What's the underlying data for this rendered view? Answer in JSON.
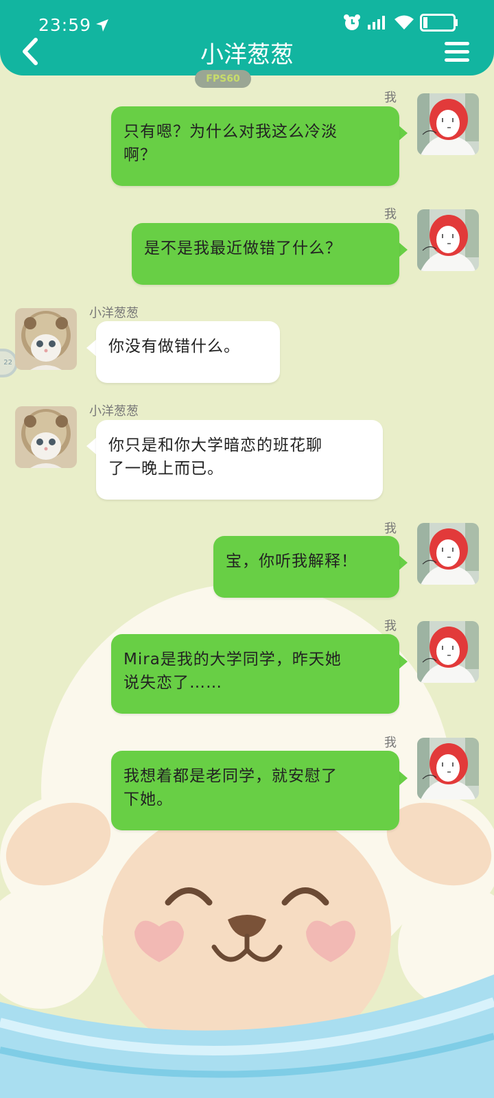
{
  "status_bar": {
    "time": "23:59",
    "location_icon": "navigation-arrow-icon",
    "alarm_icon": "alarm-clock-icon",
    "signal_icon": "signal-bars-icon",
    "wifi_icon": "wifi-icon",
    "battery_icon": "battery-icon"
  },
  "header": {
    "title": "小洋葱葱",
    "back_icon": "chevron-left-icon",
    "menu_icon": "hamburger-menu-icon",
    "fps_badge": "FPS60"
  },
  "float_ball": {
    "label": "22"
  },
  "colors": {
    "header": "#12b5a0",
    "my_bubble": "#68cf45",
    "their_bubble": "#ffffff",
    "background": "#e9eec9"
  },
  "messages": [
    {
      "sender": "我",
      "side": "right",
      "text_lines": [
        "只有嗯？为什么对我这么冷淡",
        "啊？"
      ]
    },
    {
      "sender": "我",
      "side": "right",
      "text_lines": [
        "是不是我最近做错了什么？"
      ]
    },
    {
      "sender": "小洋葱葱",
      "side": "left",
      "text_lines": [
        "你没有做错什么。"
      ]
    },
    {
      "sender": "小洋葱葱",
      "side": "left",
      "text_lines": [
        "你只是和你大学暗恋的班花聊",
        "了一晚上而已。"
      ]
    },
    {
      "sender": "我",
      "side": "right",
      "text_lines": [
        "宝，你听我解释！"
      ]
    },
    {
      "sender": "我",
      "side": "right",
      "text_lines": [
        "Mira是我的大学同学，昨天她",
        "说失恋了……"
      ]
    },
    {
      "sender": "我",
      "side": "right",
      "text_lines": [
        "我想着都是老同学，就安慰了",
        "下她。"
      ]
    }
  ]
}
